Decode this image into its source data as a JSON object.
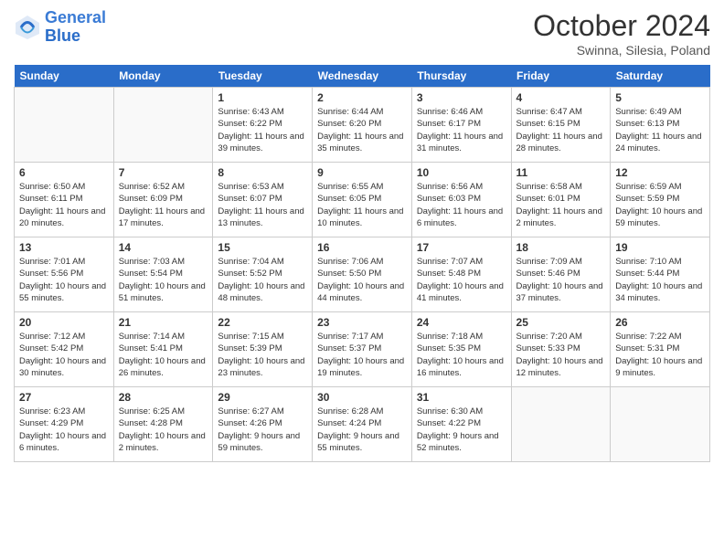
{
  "logo": {
    "line1": "General",
    "line2": "Blue"
  },
  "title": "October 2024",
  "subtitle": "Swinna, Silesia, Poland",
  "header_days": [
    "Sunday",
    "Monday",
    "Tuesday",
    "Wednesday",
    "Thursday",
    "Friday",
    "Saturday"
  ],
  "weeks": [
    [
      {
        "day": "",
        "sunrise": "",
        "sunset": "",
        "daylight": ""
      },
      {
        "day": "",
        "sunrise": "",
        "sunset": "",
        "daylight": ""
      },
      {
        "day": "1",
        "sunrise": "Sunrise: 6:43 AM",
        "sunset": "Sunset: 6:22 PM",
        "daylight": "Daylight: 11 hours and 39 minutes."
      },
      {
        "day": "2",
        "sunrise": "Sunrise: 6:44 AM",
        "sunset": "Sunset: 6:20 PM",
        "daylight": "Daylight: 11 hours and 35 minutes."
      },
      {
        "day": "3",
        "sunrise": "Sunrise: 6:46 AM",
        "sunset": "Sunset: 6:17 PM",
        "daylight": "Daylight: 11 hours and 31 minutes."
      },
      {
        "day": "4",
        "sunrise": "Sunrise: 6:47 AM",
        "sunset": "Sunset: 6:15 PM",
        "daylight": "Daylight: 11 hours and 28 minutes."
      },
      {
        "day": "5",
        "sunrise": "Sunrise: 6:49 AM",
        "sunset": "Sunset: 6:13 PM",
        "daylight": "Daylight: 11 hours and 24 minutes."
      }
    ],
    [
      {
        "day": "6",
        "sunrise": "Sunrise: 6:50 AM",
        "sunset": "Sunset: 6:11 PM",
        "daylight": "Daylight: 11 hours and 20 minutes."
      },
      {
        "day": "7",
        "sunrise": "Sunrise: 6:52 AM",
        "sunset": "Sunset: 6:09 PM",
        "daylight": "Daylight: 11 hours and 17 minutes."
      },
      {
        "day": "8",
        "sunrise": "Sunrise: 6:53 AM",
        "sunset": "Sunset: 6:07 PM",
        "daylight": "Daylight: 11 hours and 13 minutes."
      },
      {
        "day": "9",
        "sunrise": "Sunrise: 6:55 AM",
        "sunset": "Sunset: 6:05 PM",
        "daylight": "Daylight: 11 hours and 10 minutes."
      },
      {
        "day": "10",
        "sunrise": "Sunrise: 6:56 AM",
        "sunset": "Sunset: 6:03 PM",
        "daylight": "Daylight: 11 hours and 6 minutes."
      },
      {
        "day": "11",
        "sunrise": "Sunrise: 6:58 AM",
        "sunset": "Sunset: 6:01 PM",
        "daylight": "Daylight: 11 hours and 2 minutes."
      },
      {
        "day": "12",
        "sunrise": "Sunrise: 6:59 AM",
        "sunset": "Sunset: 5:59 PM",
        "daylight": "Daylight: 10 hours and 59 minutes."
      }
    ],
    [
      {
        "day": "13",
        "sunrise": "Sunrise: 7:01 AM",
        "sunset": "Sunset: 5:56 PM",
        "daylight": "Daylight: 10 hours and 55 minutes."
      },
      {
        "day": "14",
        "sunrise": "Sunrise: 7:03 AM",
        "sunset": "Sunset: 5:54 PM",
        "daylight": "Daylight: 10 hours and 51 minutes."
      },
      {
        "day": "15",
        "sunrise": "Sunrise: 7:04 AM",
        "sunset": "Sunset: 5:52 PM",
        "daylight": "Daylight: 10 hours and 48 minutes."
      },
      {
        "day": "16",
        "sunrise": "Sunrise: 7:06 AM",
        "sunset": "Sunset: 5:50 PM",
        "daylight": "Daylight: 10 hours and 44 minutes."
      },
      {
        "day": "17",
        "sunrise": "Sunrise: 7:07 AM",
        "sunset": "Sunset: 5:48 PM",
        "daylight": "Daylight: 10 hours and 41 minutes."
      },
      {
        "day": "18",
        "sunrise": "Sunrise: 7:09 AM",
        "sunset": "Sunset: 5:46 PM",
        "daylight": "Daylight: 10 hours and 37 minutes."
      },
      {
        "day": "19",
        "sunrise": "Sunrise: 7:10 AM",
        "sunset": "Sunset: 5:44 PM",
        "daylight": "Daylight: 10 hours and 34 minutes."
      }
    ],
    [
      {
        "day": "20",
        "sunrise": "Sunrise: 7:12 AM",
        "sunset": "Sunset: 5:42 PM",
        "daylight": "Daylight: 10 hours and 30 minutes."
      },
      {
        "day": "21",
        "sunrise": "Sunrise: 7:14 AM",
        "sunset": "Sunset: 5:41 PM",
        "daylight": "Daylight: 10 hours and 26 minutes."
      },
      {
        "day": "22",
        "sunrise": "Sunrise: 7:15 AM",
        "sunset": "Sunset: 5:39 PM",
        "daylight": "Daylight: 10 hours and 23 minutes."
      },
      {
        "day": "23",
        "sunrise": "Sunrise: 7:17 AM",
        "sunset": "Sunset: 5:37 PM",
        "daylight": "Daylight: 10 hours and 19 minutes."
      },
      {
        "day": "24",
        "sunrise": "Sunrise: 7:18 AM",
        "sunset": "Sunset: 5:35 PM",
        "daylight": "Daylight: 10 hours and 16 minutes."
      },
      {
        "day": "25",
        "sunrise": "Sunrise: 7:20 AM",
        "sunset": "Sunset: 5:33 PM",
        "daylight": "Daylight: 10 hours and 12 minutes."
      },
      {
        "day": "26",
        "sunrise": "Sunrise: 7:22 AM",
        "sunset": "Sunset: 5:31 PM",
        "daylight": "Daylight: 10 hours and 9 minutes."
      }
    ],
    [
      {
        "day": "27",
        "sunrise": "Sunrise: 6:23 AM",
        "sunset": "Sunset: 4:29 PM",
        "daylight": "Daylight: 10 hours and 6 minutes."
      },
      {
        "day": "28",
        "sunrise": "Sunrise: 6:25 AM",
        "sunset": "Sunset: 4:28 PM",
        "daylight": "Daylight: 10 hours and 2 minutes."
      },
      {
        "day": "29",
        "sunrise": "Sunrise: 6:27 AM",
        "sunset": "Sunset: 4:26 PM",
        "daylight": "Daylight: 9 hours and 59 minutes."
      },
      {
        "day": "30",
        "sunrise": "Sunrise: 6:28 AM",
        "sunset": "Sunset: 4:24 PM",
        "daylight": "Daylight: 9 hours and 55 minutes."
      },
      {
        "day": "31",
        "sunrise": "Sunrise: 6:30 AM",
        "sunset": "Sunset: 4:22 PM",
        "daylight": "Daylight: 9 hours and 52 minutes."
      },
      {
        "day": "",
        "sunrise": "",
        "sunset": "",
        "daylight": ""
      },
      {
        "day": "",
        "sunrise": "",
        "sunset": "",
        "daylight": ""
      }
    ]
  ]
}
